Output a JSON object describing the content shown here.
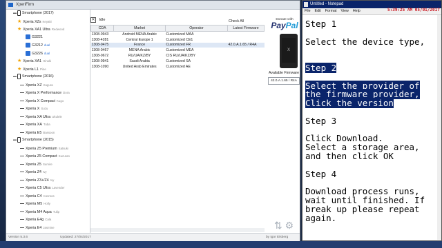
{
  "xperifirm": {
    "title": "XperiFirm",
    "tree": [
      {
        "type": "group",
        "label": "Smartphone (2017)"
      },
      {
        "type": "star",
        "label": "Xperia XZs",
        "sub": "Keyaki"
      },
      {
        "type": "star",
        "label": "Xperia XA1 Ultra",
        "sub": "Redwood"
      },
      {
        "type": "variant",
        "label": "G3221",
        "sub": ""
      },
      {
        "type": "variant",
        "label": "G3212",
        "sub": "dual"
      },
      {
        "type": "variant",
        "label": "G3226",
        "sub": "dual"
      },
      {
        "type": "star",
        "label": "Xperia XA1",
        "sub": "Hinoki"
      },
      {
        "type": "star",
        "label": "Xperia L1",
        "sub": "Pine"
      },
      {
        "type": "group",
        "label": "Smartphone (2016)"
      },
      {
        "type": "item",
        "label": "Xperia XZ",
        "sub": "Kagura"
      },
      {
        "type": "item",
        "label": "Xperia X Performance",
        "sub": "Dora"
      },
      {
        "type": "item",
        "label": "Xperia X Compact",
        "sub": "Kugo"
      },
      {
        "type": "item",
        "label": "Xperia X",
        "sub": "Suzu"
      },
      {
        "type": "item",
        "label": "Xperia XA Ultra",
        "sub": "Ukulele"
      },
      {
        "type": "item",
        "label": "Xperia XA",
        "sub": "Tuba"
      },
      {
        "type": "item",
        "label": "Xperia E5",
        "sub": "Bassoon"
      },
      {
        "type": "group",
        "label": "Smartphone (2015)"
      },
      {
        "type": "item",
        "label": "Xperia Z5 Premium",
        "sub": "Satsuki"
      },
      {
        "type": "item",
        "label": "Xperia Z5 Compact",
        "sub": "Suzuran"
      },
      {
        "type": "item",
        "label": "Xperia Z5",
        "sub": "Sumire"
      },
      {
        "type": "item",
        "label": "Xperia Z4",
        "sub": "Ivy"
      },
      {
        "type": "item",
        "label": "Xperia Z3+/Z4",
        "sub": "Ivy"
      },
      {
        "type": "item",
        "label": "Xperia C5 Ultra",
        "sub": "Lavender"
      },
      {
        "type": "item",
        "label": "Xperia C4",
        "sub": "Cosmos"
      },
      {
        "type": "item",
        "label": "Xperia M5",
        "sub": "Holly"
      },
      {
        "type": "item",
        "label": "Xperia M4 Aqua",
        "sub": "Tulip"
      },
      {
        "type": "item",
        "label": "Xperia E4g",
        "sub": "Cala"
      },
      {
        "type": "item",
        "label": "Xperia E4",
        "sub": "Jasmine"
      }
    ],
    "status_label": "Idle",
    "check_all": "Check All",
    "columns": [
      "CDA",
      "Market",
      "Operator",
      "Latest Firmware"
    ],
    "rows": [
      [
        "1308-0943",
        "Android MENA Arabic",
        "Customized MAA",
        ""
      ],
      [
        "1308-4281",
        "Central Europe 1",
        "Customized CE1",
        ""
      ],
      [
        "1308-0475",
        "France",
        "Customized FR",
        "42.0.A.1.65 / R4A"
      ],
      [
        "1308-0467",
        "MENA Arabic",
        "Customized MEA",
        ""
      ],
      [
        "1308-0672",
        "RU/UA/KZ/BY",
        "CIS RU/UA/KZ/BY",
        ""
      ],
      [
        "1308-0941",
        "Saudi Arabia",
        "Customized SA",
        ""
      ],
      [
        "1308-1090",
        "United Arab Emirates",
        "Customized AE",
        ""
      ]
    ],
    "selected_row": 2,
    "donate_label": "Donate with",
    "paypal_a": "Pay",
    "paypal_b": "Pal",
    "available_label": "Available Firmware",
    "available_value": "42.0.A.1.65 / R4A",
    "version": "Version 5.3.6",
    "updated": "Updated: 27/04/2017",
    "author": "by Igor Eisberg"
  },
  "notepad": {
    "title": "Untitled - Notepad",
    "clock": "5:39:25 AM 05/01/2017",
    "menu": [
      "File",
      "Edit",
      "Format",
      "View",
      "Help"
    ],
    "lines": [
      {
        "t": "Step 1",
        "hl": false
      },
      {
        "t": "",
        "hl": false
      },
      {
        "t": "Select the device type,",
        "hl": false
      },
      {
        "t": "",
        "hl": false
      },
      {
        "t": "",
        "hl": false
      },
      {
        "t": "Step 2",
        "hl": true
      },
      {
        "t": "",
        "hl": false
      },
      {
        "t": "Select the provider of",
        "hl": true
      },
      {
        "t": "the firmware provider,",
        "hl": true
      },
      {
        "t": "Click the version",
        "hl": true
      },
      {
        "t": "",
        "hl": false
      },
      {
        "t": "Step 3",
        "hl": false
      },
      {
        "t": "",
        "hl": false
      },
      {
        "t": "Click Download.",
        "hl": false
      },
      {
        "t": "Select a storage area,",
        "hl": false
      },
      {
        "t": "and then click OK",
        "hl": false
      },
      {
        "t": "",
        "hl": false
      },
      {
        "t": "Step 4",
        "hl": false
      },
      {
        "t": "",
        "hl": false
      },
      {
        "t": "Download process runs,",
        "hl": false
      },
      {
        "t": "wait until finished. If",
        "hl": false
      },
      {
        "t": "break up please repeat",
        "hl": false
      },
      {
        "t": "again.",
        "hl": false
      }
    ]
  }
}
